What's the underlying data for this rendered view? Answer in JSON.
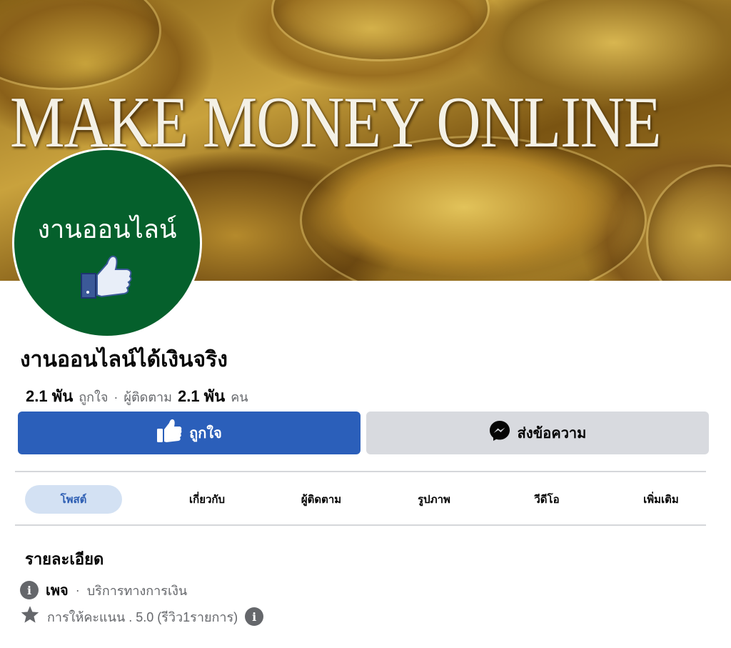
{
  "cover": {
    "title": "MAKE MONEY ONLINE"
  },
  "avatar": {
    "text": "งานออนไลน์"
  },
  "page": {
    "name": "งานออนไลน์ได้เงินจริง",
    "likes_count": "2.1 พัน",
    "likes_label": "ถูกใจ",
    "separator": "·",
    "followers_label": "ผู้ติดตาม",
    "followers_count": "2.1 พัน",
    "followers_unit": "คน"
  },
  "actions": {
    "like_label": "ถูกใจ",
    "message_label": "ส่งข้อความ"
  },
  "tabs": [
    {
      "label": "โพสต์",
      "active": true
    },
    {
      "label": "เกี่ยวกับ",
      "active": false
    },
    {
      "label": "ผู้ติดตาม",
      "active": false
    },
    {
      "label": "รูปภาพ",
      "active": false
    },
    {
      "label": "วีดีโอ",
      "active": false
    },
    {
      "label": "เพิ่มเติม",
      "active": false
    }
  ],
  "details": {
    "title": "รายละเอียด",
    "type_label": "เพจ",
    "separator": "·",
    "category": "บริการทางการเงิน",
    "rating_text": "การให้คะแนน . 5.0 (รีวิว1รายการ)"
  },
  "colors": {
    "primary_button": "#2b5fba",
    "secondary_button": "#d8dadf",
    "active_tab_bg": "#d3e1f3",
    "active_tab_text": "#2d5eb3",
    "avatar_bg": "#05602c",
    "muted_text": "#65676b"
  },
  "icons": {
    "like_button_icon": "thumbs-up-icon",
    "message_button_icon": "messenger-icon",
    "info_icon": "info-icon",
    "rating_icon": "star-icon",
    "rating_info_icon": "info-icon"
  }
}
